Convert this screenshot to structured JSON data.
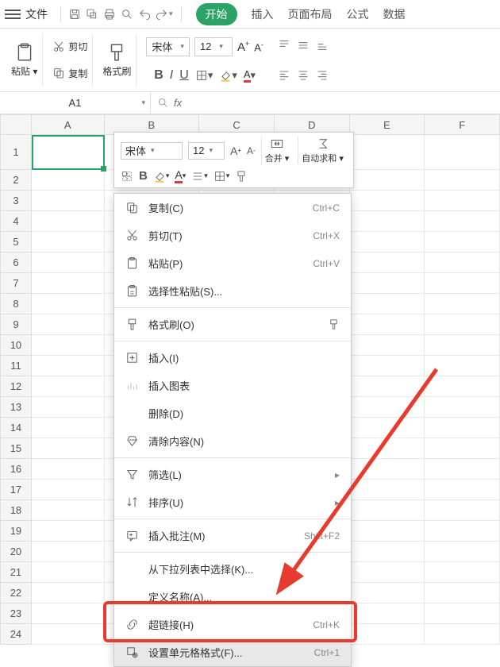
{
  "titlebar": {
    "file": "文件"
  },
  "tabs": {
    "start": "开始",
    "insert": "插入",
    "layout": "页面布局",
    "formula": "公式",
    "data": "数据"
  },
  "ribbon": {
    "paste": "粘贴",
    "cut": "剪切",
    "copy": "复制",
    "fmtPainter": "格式刷",
    "font": "宋体",
    "size": "12"
  },
  "namebox": "A1",
  "columns": [
    "A",
    "B",
    "C",
    "D",
    "E",
    "F"
  ],
  "rows": [
    "1",
    "2",
    "3",
    "4",
    "5",
    "6",
    "7",
    "8",
    "9",
    "10",
    "11",
    "12",
    "13",
    "14",
    "15",
    "16",
    "17",
    "18",
    "19",
    "20",
    "21",
    "22",
    "23",
    "24"
  ],
  "mini": {
    "font": "宋体",
    "size": "12",
    "merge": "合并",
    "autosum": "自动求和"
  },
  "ctx": {
    "copy": {
      "lbl": "复制(C)",
      "accel": "Ctrl+C"
    },
    "cut": {
      "lbl": "剪切(T)",
      "accel": "Ctrl+X"
    },
    "paste": {
      "lbl": "粘贴(P)",
      "accel": "Ctrl+V"
    },
    "pastespecial": {
      "lbl": "选择性粘贴(S)..."
    },
    "fmtpainter": {
      "lbl": "格式刷(O)"
    },
    "insert": {
      "lbl": "插入(I)"
    },
    "insertchart": {
      "lbl": "插入图表"
    },
    "delete": {
      "lbl": "删除(D)"
    },
    "clear": {
      "lbl": "清除内容(N)"
    },
    "filter": {
      "lbl": "筛选(L)"
    },
    "sort": {
      "lbl": "排序(U)"
    },
    "comment": {
      "lbl": "插入批注(M)",
      "accel": "Shift+F2"
    },
    "fromlist": {
      "lbl": "从下拉列表中选择(K)..."
    },
    "definename": {
      "lbl": "定义名称(A)..."
    },
    "hyperlink": {
      "lbl": "超链接(H)",
      "accel": "Ctrl+K"
    },
    "format": {
      "lbl": "设置单元格格式(F)...",
      "accel": "Ctrl+1"
    }
  }
}
